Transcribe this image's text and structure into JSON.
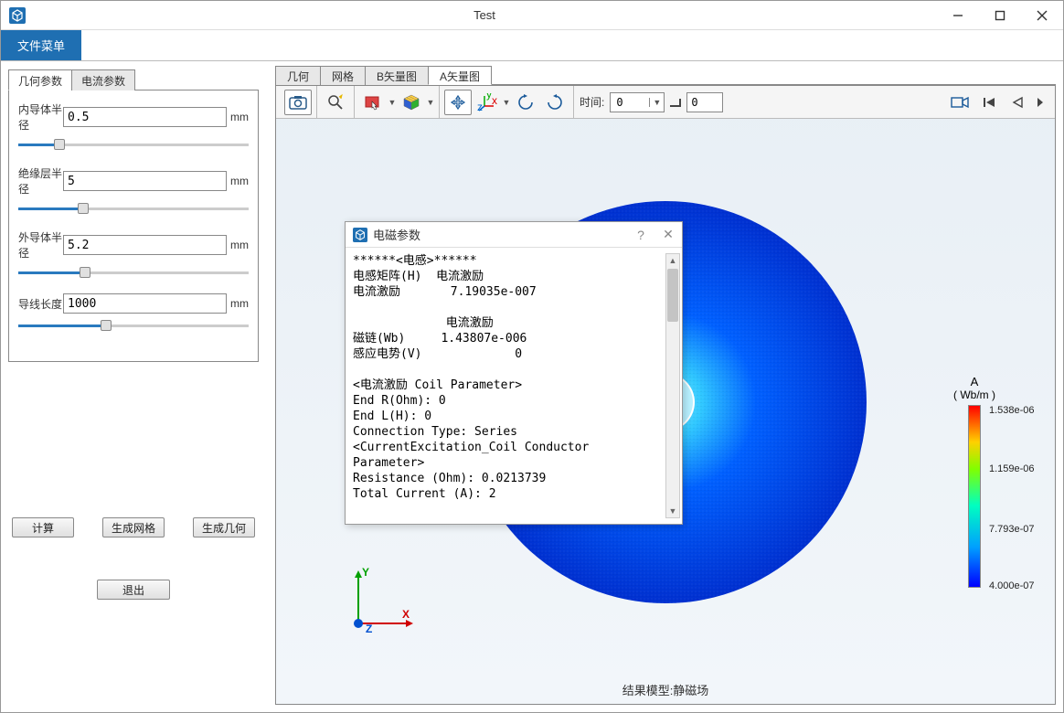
{
  "window": {
    "title": "Test"
  },
  "menubar": {
    "file": "文件菜单"
  },
  "left_tabs": {
    "geom": "几何参数",
    "current": "电流参数"
  },
  "params": {
    "r_inner": {
      "label": "内导体半径",
      "value": "0.5",
      "unit": "mm",
      "pct": 18
    },
    "r_insul": {
      "label": "绝缘层半径",
      "value": "5",
      "unit": "mm",
      "pct": 28
    },
    "r_outer": {
      "label": "外导体半径",
      "value": "5.2",
      "unit": "mm",
      "pct": 29
    },
    "len": {
      "label": "导线长度",
      "value": "1000",
      "unit": "mm",
      "pct": 38
    }
  },
  "buttons": {
    "compute": "计算",
    "mesh": "生成网格",
    "geom": "生成几何",
    "exit": "退出"
  },
  "right_tabs": {
    "geom": "几何",
    "mesh": "网格",
    "bvec": "B矢量图",
    "avec": "A矢量图"
  },
  "toolbar": {
    "time_label": "时间:",
    "time_combo": "0",
    "time_input": "0"
  },
  "result_label": "结果模型:静磁场",
  "colorbar": {
    "title1": "A",
    "title2": "( Wb/m )",
    "ticks": [
      "1.538e-06",
      "1.159e-06",
      "7.793e-07",
      "4.000e-07"
    ]
  },
  "dialog": {
    "title": "电磁参数",
    "body": "******<电感>******\n电感矩阵(H)  电流激励\n电流激励       7.19035e-007\n\n             电流激励\n磁链(Wb)     1.43807e-006\n感应电势(V)             0\n\n<电流激励 Coil Parameter>\nEnd R(Ohm): 0\nEnd L(H): 0\nConnection Type: Series\n<CurrentExcitation_Coil Conductor\nParameter>\nResistance (Ohm): 0.0213739\nTotal Current (A): 2"
  },
  "axes": {
    "x": "X",
    "y": "Y",
    "z": "Z"
  }
}
